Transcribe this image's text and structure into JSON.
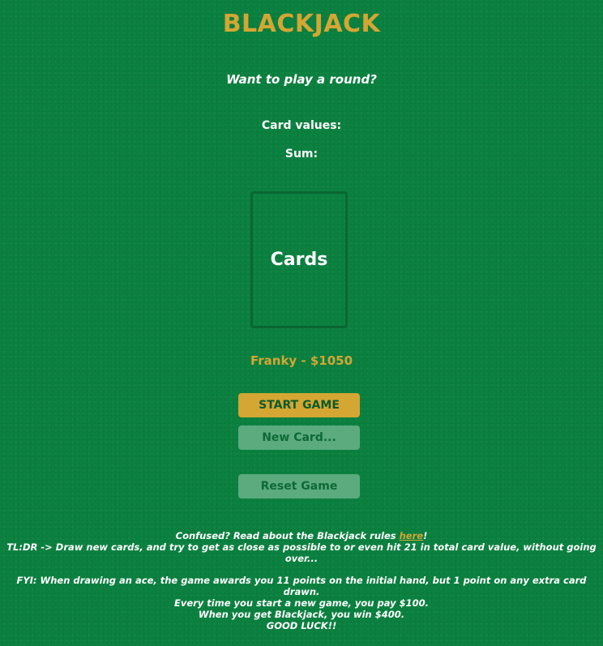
{
  "header": {
    "title": "BLACKJACK",
    "subtitle": "Want to play a round?"
  },
  "stats": {
    "card_values_label": "Card values:",
    "sum_label": "Sum:"
  },
  "card_area": {
    "placeholder": "Cards"
  },
  "player": {
    "text": "Franky - $1050"
  },
  "buttons": {
    "start": "START GAME",
    "new_card": "New Card...",
    "reset": "Reset Game"
  },
  "info": {
    "confused_prefix": "Confused? Read about the Blackjack rules ",
    "rules_link": "here",
    "confused_suffix": "!",
    "tldr": "TL:DR -> Draw new cards, and try to get as close as possible to or even hit 21 in total card value, without going over...",
    "fyi": "FYI: When drawing an ace, the game awards you 11 points on the initial hand, but 1 point on any extra card drawn.",
    "cost": "Every time you start a new game, you pay $100.",
    "win": "When you get Blackjack, you win $400.",
    "luck": "GOOD LUCK!!"
  },
  "colors": {
    "felt": "#0b8140",
    "gold": "#d4a633",
    "disabled_button": "#5bab7f",
    "card_border": "#0a6631"
  }
}
